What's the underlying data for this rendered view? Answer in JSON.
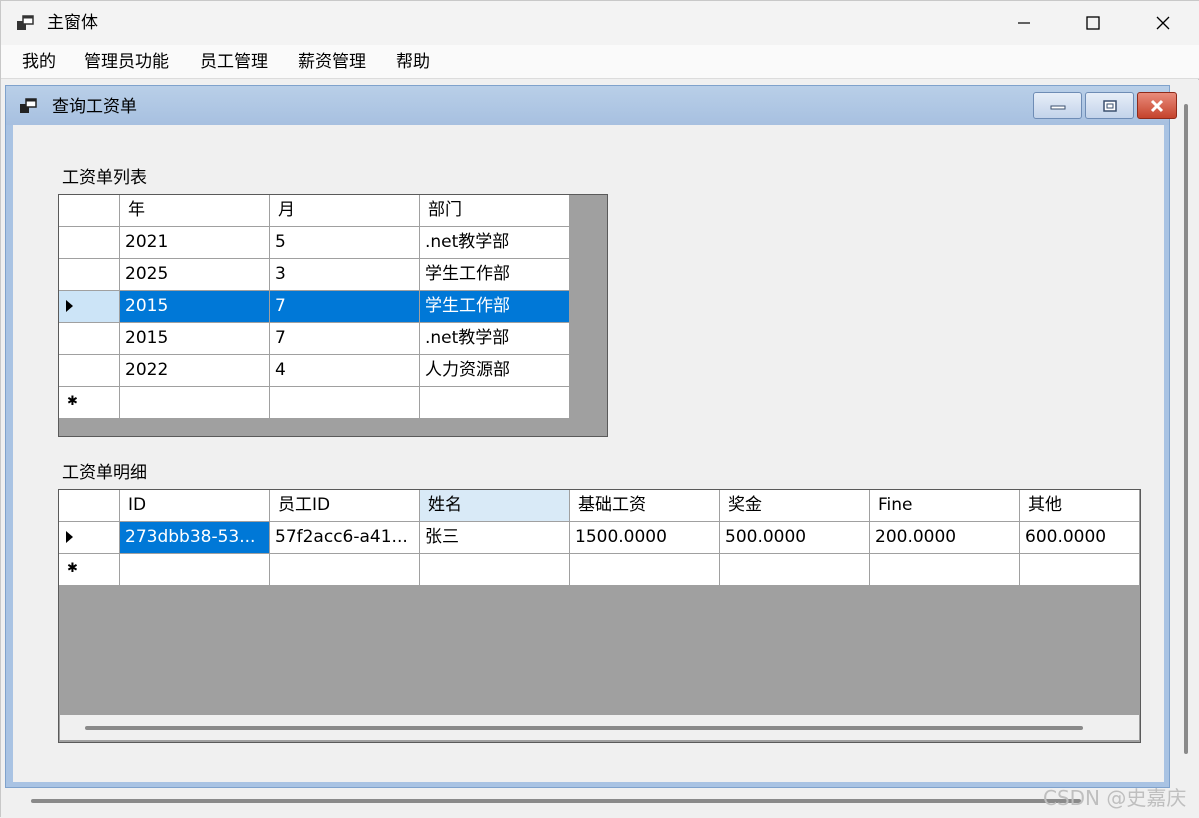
{
  "window": {
    "title": "主窗体",
    "controls": {
      "minimize_icon": "minimize-icon",
      "maximize_icon": "maximize-icon",
      "close_icon": "close-icon"
    }
  },
  "menu": [
    "我的",
    "管理员功能",
    "员工管理",
    "薪资管理",
    "帮助"
  ],
  "child": {
    "title": "查询工资单"
  },
  "salary_list": {
    "label": "工资单列表",
    "columns": [
      "年",
      "月",
      "部门"
    ],
    "rows": [
      [
        "2021",
        "5",
        ".net教学部"
      ],
      [
        "2025",
        "3",
        "学生工作部"
      ],
      [
        "2015",
        "7",
        "学生工作部"
      ],
      [
        "2015",
        "7",
        ".net教学部"
      ],
      [
        "2022",
        "4",
        "人力资源部"
      ]
    ],
    "selected_row_index": 2
  },
  "salary_detail": {
    "label": "工资单明细",
    "columns": [
      "ID",
      "员工ID",
      "姓名",
      "基础工资",
      "奖金",
      "Fine",
      "其他"
    ],
    "rows": [
      [
        "273dbb38-53...",
        "57f2acc6-a41...",
        "张三",
        "1500.0000",
        "500.0000",
        "200.0000",
        "600.0000"
      ]
    ],
    "selected_cell": "ID"
  },
  "watermark": "CSDN @史嘉庆",
  "colors": {
    "selection": "#0078d7",
    "child_titlebar": "#a7c0e0",
    "grid_background": "#a0a0a0"
  }
}
